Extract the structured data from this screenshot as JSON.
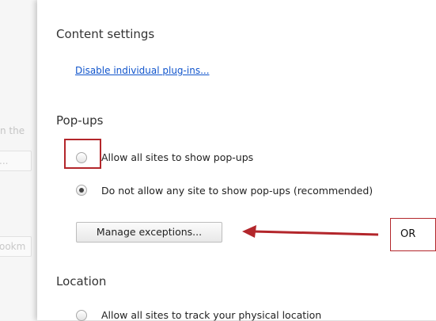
{
  "background": {
    "partial_text_1": "n the",
    "partial_button_1": "...",
    "partial_text_2": "ookm"
  },
  "dialog": {
    "title": "Content settings",
    "plugins_link": "Disable individual plug-ins...",
    "popups": {
      "heading": "Pop-ups",
      "options": [
        {
          "label": "Allow all sites to show pop-ups",
          "selected": false
        },
        {
          "label": "Do not allow any site to show pop-ups (recommended)",
          "selected": true
        }
      ],
      "manage_button": "Manage exceptions..."
    },
    "location": {
      "heading": "Location",
      "options": [
        {
          "label": "Allow all sites to track your physical location",
          "selected": false
        }
      ]
    }
  },
  "annotations": {
    "or_label": "OR",
    "highlight_color": "#b3262b",
    "arrow_color": "#b3262b"
  },
  "colors": {
    "link": "#1155cc"
  }
}
